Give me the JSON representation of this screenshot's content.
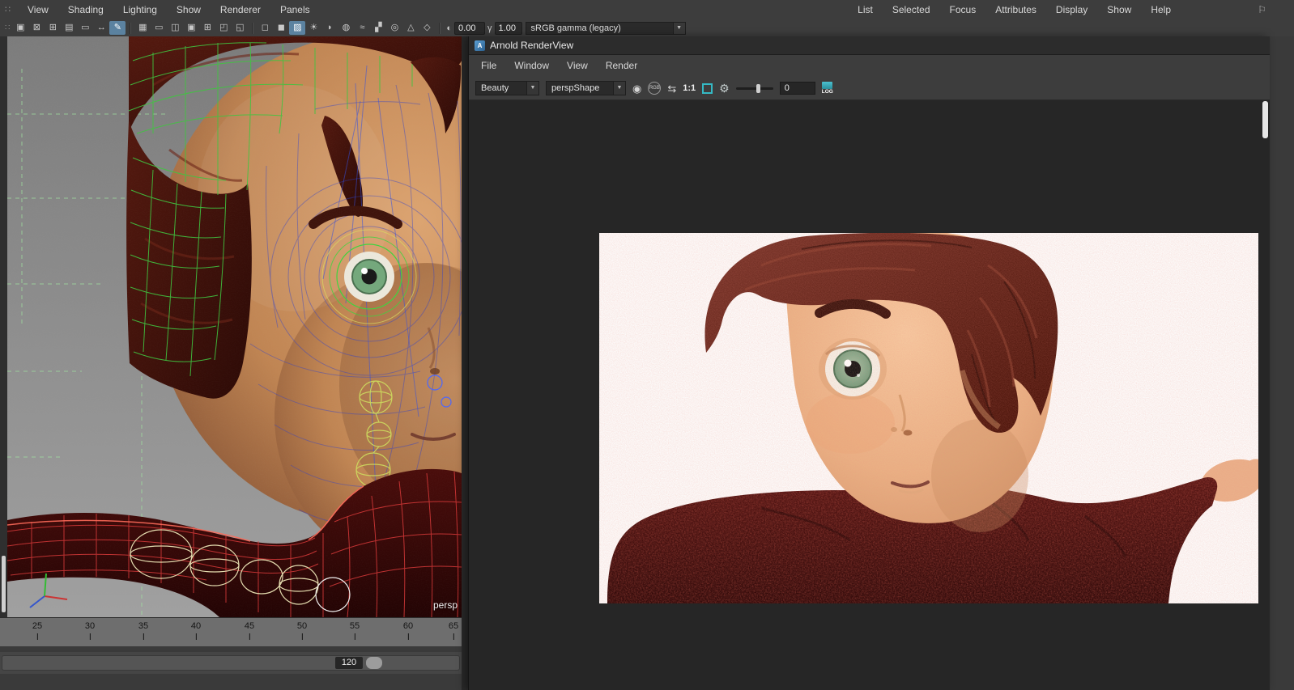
{
  "maya": {
    "menu_bar": {
      "items": [
        "View",
        "Shading",
        "Lighting",
        "Show",
        "Renderer",
        "Panels"
      ]
    },
    "right_menu_bar": {
      "items": [
        "List",
        "Selected",
        "Focus",
        "Attributes",
        "Display",
        "Show",
        "Help"
      ]
    },
    "viewport_toolbar": {
      "icons": [
        {
          "name": "select-camera-icon",
          "glyph": "▣"
        },
        {
          "name": "lock-camera-icon",
          "glyph": "⊠"
        },
        {
          "name": "camera-attributes-icon",
          "glyph": "⊞"
        },
        {
          "name": "bookmark-icon",
          "glyph": "▤"
        },
        {
          "name": "image-plane-icon",
          "glyph": "▭"
        },
        {
          "name": "two-d-pan-zoom-icon",
          "glyph": "↔"
        },
        {
          "name": "grease-pencil-icon",
          "glyph": "✎",
          "active": true
        },
        {
          "name": "grid-icon",
          "glyph": "▦"
        },
        {
          "name": "film-gate-icon",
          "glyph": "▭"
        },
        {
          "name": "resolution-gate-icon",
          "glyph": "◫"
        },
        {
          "name": "gate-mask-icon",
          "glyph": "▣"
        },
        {
          "name": "field-chart-icon",
          "glyph": "⊞"
        },
        {
          "name": "safe-action-icon",
          "glyph": "◰"
        },
        {
          "name": "safe-title-icon",
          "glyph": "◱"
        },
        {
          "name": "wireframe-icon",
          "glyph": "◻"
        },
        {
          "name": "shaded-icon",
          "glyph": "◼"
        },
        {
          "name": "textured-icon",
          "glyph": "▨",
          "active": true
        },
        {
          "name": "use-all-lights-icon",
          "glyph": "☀"
        },
        {
          "name": "shadows-icon",
          "glyph": "◗"
        },
        {
          "name": "screen-space-ao-icon",
          "glyph": "◍"
        },
        {
          "name": "motion-blur-icon",
          "glyph": "≈"
        },
        {
          "name": "anti-aliasing-icon",
          "glyph": "▞"
        },
        {
          "name": "depth-of-field-icon",
          "glyph": "◎"
        },
        {
          "name": "isolate-select-icon",
          "glyph": "△"
        },
        {
          "name": "x-ray-icon",
          "glyph": "◇"
        }
      ],
      "exposure_icon_glyph": "◐",
      "exposure_value": "0.00",
      "gamma_icon_glyph": "γ",
      "gamma_value": "1.00",
      "view_transform": "sRGB gamma (legacy)"
    },
    "viewport": {
      "camera_label": "persp"
    },
    "timeline": {
      "ticks": [
        "25",
        "30",
        "35",
        "40",
        "45",
        "50",
        "55",
        "60",
        "65"
      ],
      "end_frame": "120"
    }
  },
  "arnold": {
    "window_title": "Arnold RenderView",
    "menus": [
      "File",
      "Window",
      "View",
      "Render"
    ],
    "toolbar": {
      "aov_selected": "Beauty",
      "camera_selected": "perspShape",
      "zoom_ratio": "1:1",
      "iterations_value": "0",
      "log_label": "LOG"
    },
    "colors": {
      "accent_teal": "#35b9c4",
      "titlebar": "#2c2c2c",
      "render_background": "#262626"
    }
  }
}
